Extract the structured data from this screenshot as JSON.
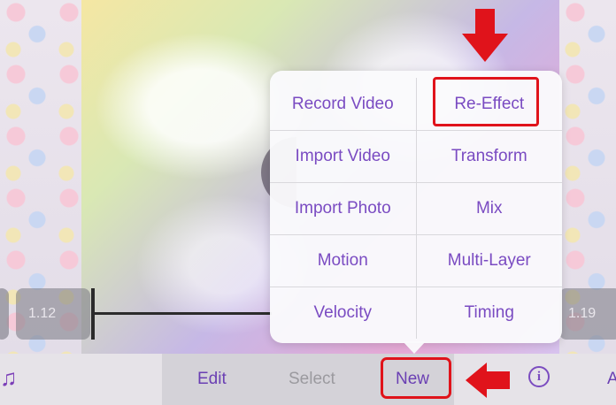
{
  "timeline": {
    "left_time": "1.12",
    "right_time": "1.19"
  },
  "menu": {
    "items": [
      [
        "Record Video",
        "Re-Effect"
      ],
      [
        "Import Video",
        "Transform"
      ],
      [
        "Import Photo",
        "Mix"
      ],
      [
        "Motion",
        "Multi-Layer"
      ],
      [
        "Velocity",
        "Timing"
      ]
    ],
    "highlighted": "Re-Effect"
  },
  "toolbar": {
    "music_icon": "music-note-icon",
    "edit": "Edit",
    "select": "Select",
    "new": "New",
    "info_icon": "info-icon",
    "info_glyph": "i",
    "partial_right": "A"
  },
  "colors": {
    "accent": "#7a4bc2",
    "highlight_red": "#e0131b",
    "disabled": "#9b9a9f"
  }
}
